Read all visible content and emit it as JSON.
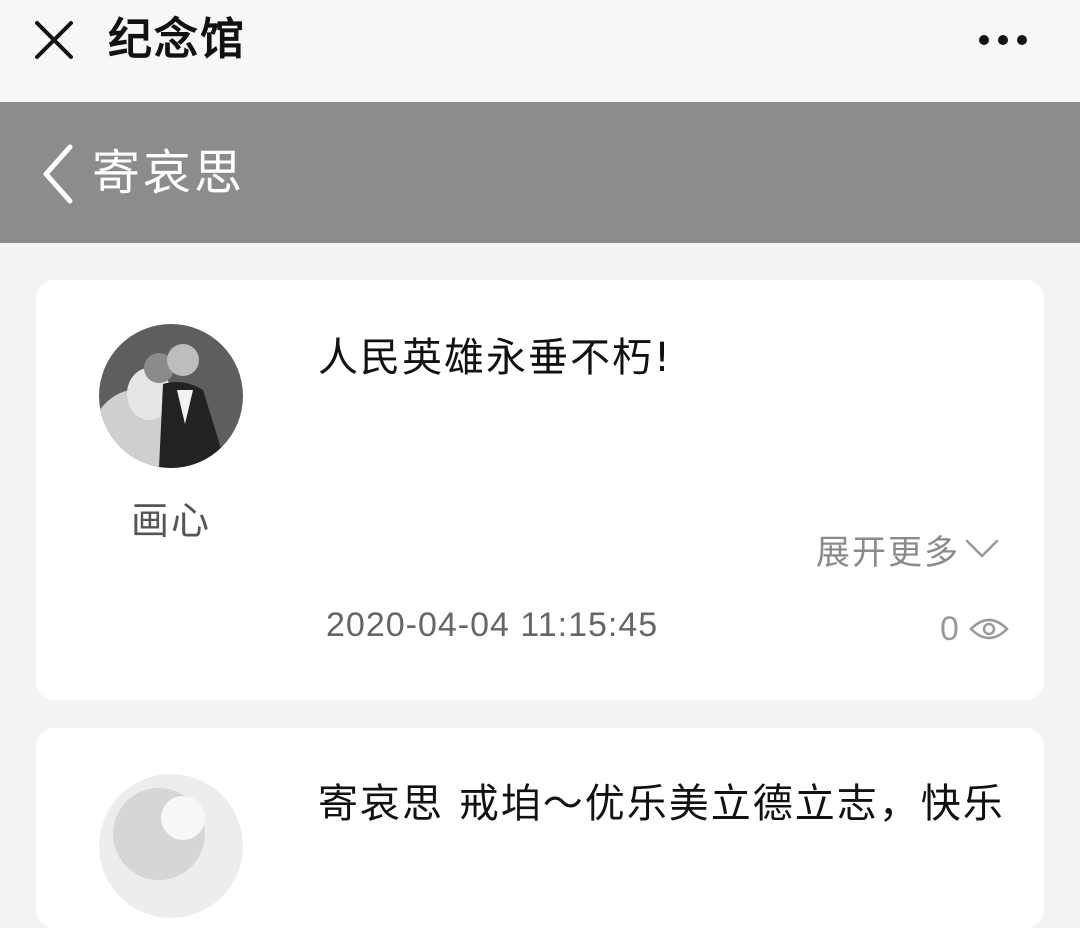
{
  "topbar": {
    "title": "纪念馆",
    "close_icon": "close-icon",
    "more_icon": "more-dots-icon"
  },
  "header": {
    "title": "寄哀思",
    "back_icon": "chevron-left-icon",
    "background": "#8c8c8c"
  },
  "messages": [
    {
      "author": "画心",
      "content": "人民英雄永垂不朽!",
      "expand_label": "展开更多",
      "timestamp": "2020-04-04 11:15:45",
      "views": "0",
      "avatar_icon": "wedding-photo-avatar",
      "view_icon": "eye-icon"
    },
    {
      "content": "寄哀思 戒垍～优乐美立德立志，快乐",
      "avatar_icon": "avatar-photo"
    }
  ]
}
